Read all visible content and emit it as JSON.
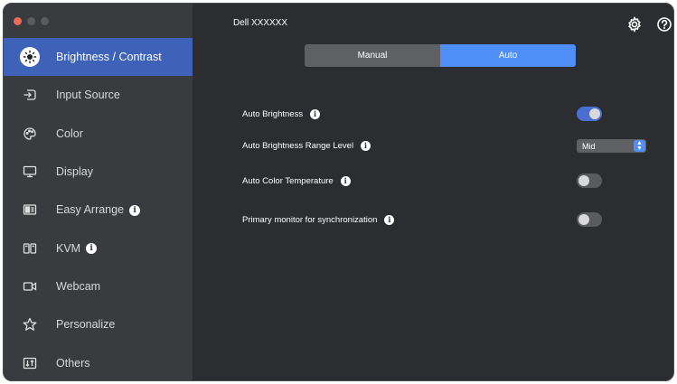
{
  "sidebar": {
    "items": [
      {
        "label": "Brightness / Contrast",
        "icon": "sun-icon",
        "active": true,
        "badge": ""
      },
      {
        "label": "Input Source",
        "icon": "input-source-icon",
        "active": false,
        "badge": ""
      },
      {
        "label": "Color",
        "icon": "palette-icon",
        "active": false,
        "badge": ""
      },
      {
        "label": "Display",
        "icon": "monitor-icon",
        "active": false,
        "badge": ""
      },
      {
        "label": "Easy Arrange",
        "icon": "layout-icon",
        "active": false,
        "badge": "i"
      },
      {
        "label": "KVM",
        "icon": "kvm-icon",
        "active": false,
        "badge": "i"
      },
      {
        "label": "Webcam",
        "icon": "webcam-icon",
        "active": false,
        "badge": ""
      },
      {
        "label": "Personalize",
        "icon": "star-icon",
        "active": false,
        "badge": ""
      },
      {
        "label": "Others",
        "icon": "others-icon",
        "active": false,
        "badge": ""
      }
    ]
  },
  "header": {
    "device_name": "Dell XXXXXX",
    "settings_icon": "gear-icon",
    "help_icon": "help-icon"
  },
  "mode": {
    "manual_label": "Manual",
    "auto_label": "Auto",
    "selected": "Auto"
  },
  "settings": {
    "auto_brightness": {
      "label": "Auto Brightness",
      "enabled": true
    },
    "range_level": {
      "label": "Auto Brightness Range Level",
      "value": "Mid"
    },
    "auto_color_temp": {
      "label": "Auto Color Temperature",
      "enabled": false
    },
    "primary_sync": {
      "label": "Primary monitor for synchronization",
      "enabled": false
    }
  },
  "info_glyph": "i",
  "colors": {
    "accent": "#4f8ef7",
    "active_nav": "#3d62b8",
    "toggle_on": "#4a6fd0"
  }
}
